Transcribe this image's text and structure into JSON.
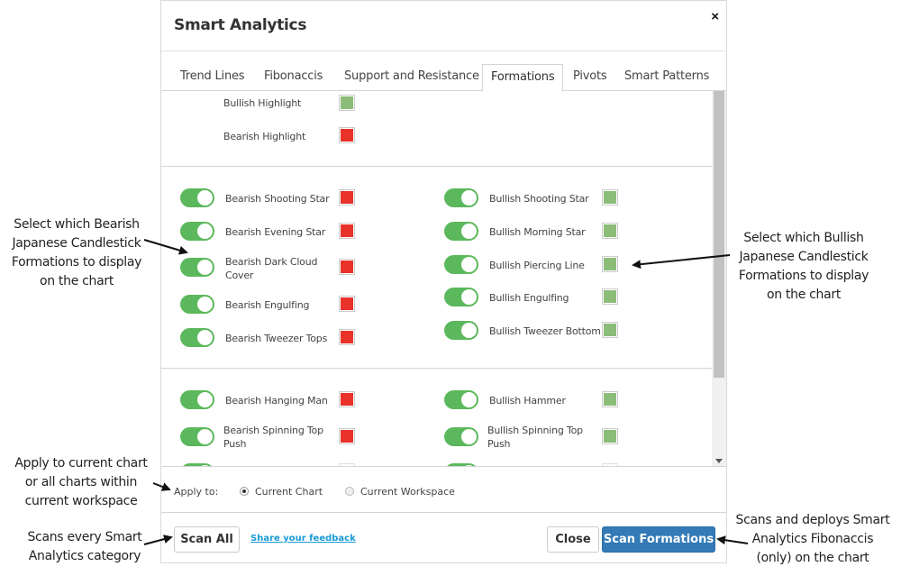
{
  "dialog": {
    "title": "Smart Analytics",
    "close_glyph": "×",
    "tabs": [
      "Trend Lines",
      "Fibonaccis",
      "Support and Resistance",
      "Formations",
      "Pivots",
      "Smart Patterns"
    ],
    "active_tab": "Formations",
    "highlights": [
      {
        "label": "Bullish Highlight",
        "color": "green"
      },
      {
        "label": "Bearish Highlight",
        "color": "red"
      }
    ],
    "bearish_group_1": [
      {
        "label": "Bearish Shooting Star",
        "enabled": true
      },
      {
        "label": "Bearish Evening Star",
        "enabled": true
      },
      {
        "label": "Bearish Dark Cloud Cover",
        "enabled": true
      },
      {
        "label": "Bearish Engulfing",
        "enabled": true
      },
      {
        "label": "Bearish Tweezer Tops",
        "enabled": true
      }
    ],
    "bullish_group_1": [
      {
        "label": "Bullish Shooting Star",
        "enabled": true
      },
      {
        "label": "Bullish Morning Star",
        "enabled": true
      },
      {
        "label": "Bullish Piercing Line",
        "enabled": true
      },
      {
        "label": "Bullish Engulfing",
        "enabled": true
      },
      {
        "label": "Bullish Tweezer Bottom",
        "enabled": true
      }
    ],
    "bearish_group_2": [
      {
        "label": "Bearish Hanging Man",
        "enabled": true
      },
      {
        "label": "Bearish Spinning Top Push",
        "enabled": true
      }
    ],
    "bullish_group_2": [
      {
        "label": "Bullish Hammer",
        "enabled": true
      },
      {
        "label": "Bullish Spinning Top Push",
        "enabled": true
      }
    ],
    "apply": {
      "label": "Apply to:",
      "options": [
        "Current Chart",
        "Current Workspace"
      ],
      "selected": "Current Chart"
    },
    "footer": {
      "scan_all": "Scan All",
      "feedback": "Share your feedback",
      "close": "Close",
      "scan_formations": "Scan Formations"
    }
  },
  "annotations": {
    "bearish_note": "Select which Bearish Japanese Candlestick Formations to display on the chart",
    "bullish_note": "Select which Bullish Japanese Candlestick Formations to display on the chart",
    "apply_note": "Apply to current chart or all charts within current workspace",
    "scan_all_note": "Scans every Smart Analytics category",
    "scan_formations_note": "Scans and deploys Smart Analytics Fibonaccis (only) on the chart"
  },
  "colors": {
    "bullish": "#8cbd78",
    "bearish": "#e8322a",
    "toggle_on": "#5cb85c",
    "primary_button": "#337ab7",
    "link": "#1a9bd7"
  }
}
